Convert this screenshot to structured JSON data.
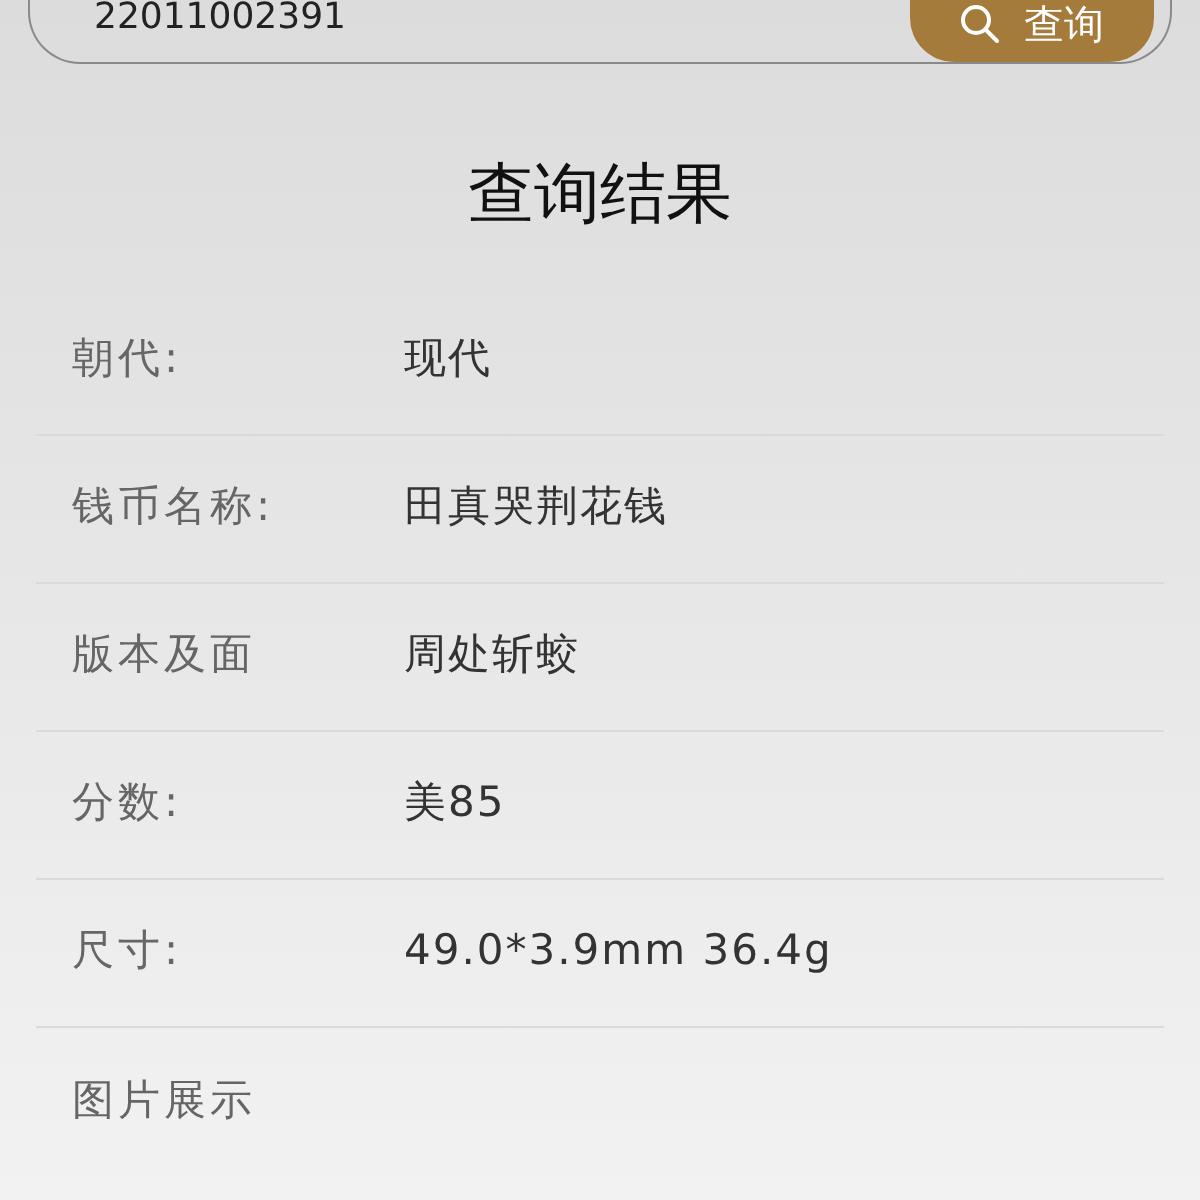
{
  "search": {
    "value": "22011002391",
    "button": "查询"
  },
  "title": "查询结果",
  "fields": [
    {
      "label": "朝代:",
      "value": "现代"
    },
    {
      "label": "钱币名称:",
      "value": "田真哭荆花钱"
    },
    {
      "label": "版本及面",
      "value": "周处斩蛟"
    },
    {
      "label": "分数:",
      "value": "美85"
    },
    {
      "label": "尺寸:",
      "value": "49.0*3.9mm 36.4g"
    },
    {
      "label": "图片展示"
    }
  ]
}
